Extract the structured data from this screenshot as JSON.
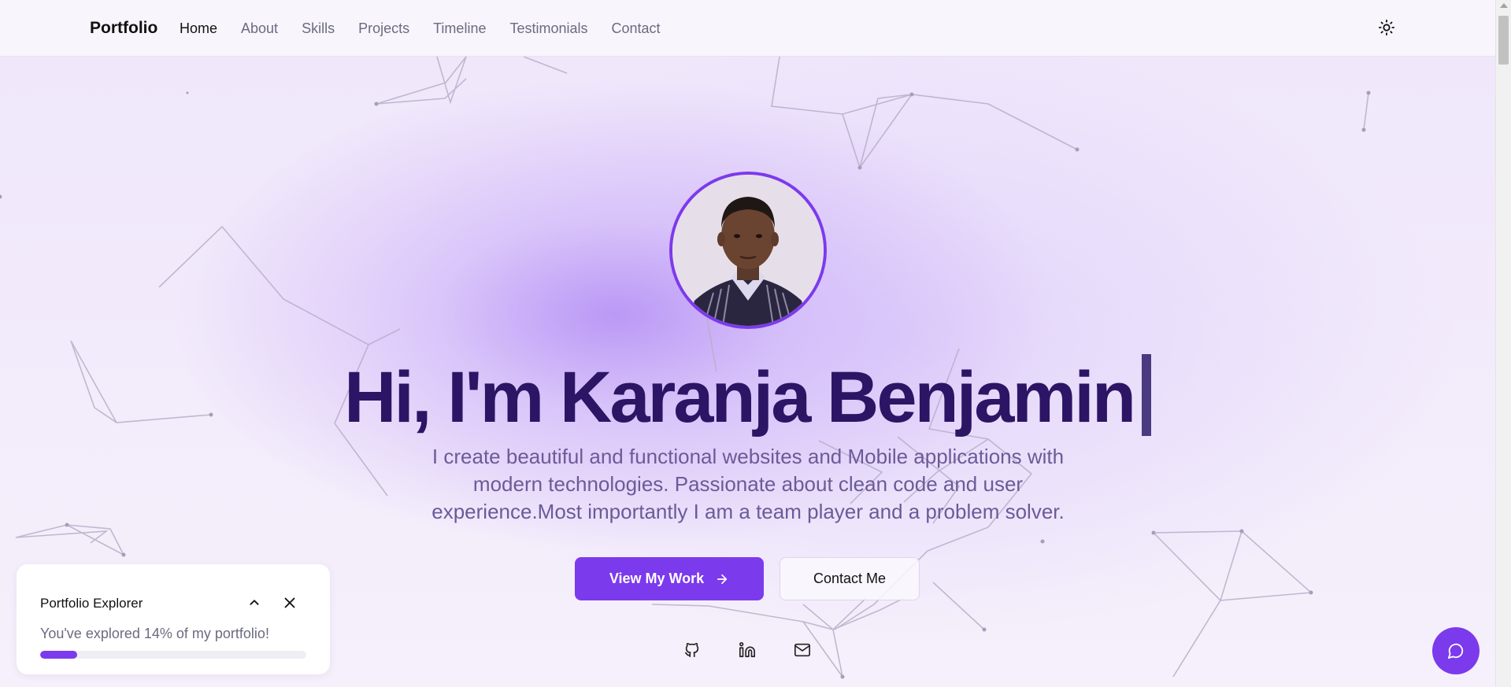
{
  "nav": {
    "brand": "Portfolio",
    "links": [
      "Home",
      "About",
      "Skills",
      "Projects",
      "Timeline",
      "Testimonials",
      "Contact"
    ],
    "active": "Home",
    "theme_icon": "sun-icon"
  },
  "hero": {
    "headline": "Hi, I'm Karanja Benjamin",
    "lead": "I create beautiful and functional websites and Mobile applications with modern technologies. Passionate about clean code and user experience.Most importantly I am a team player and a problem solver.",
    "primary_cta": "View My Work",
    "secondary_cta": "Contact Me",
    "socials": [
      "github-icon",
      "linkedin-icon",
      "mail-icon"
    ]
  },
  "explorer": {
    "title": "Portfolio Explorer",
    "message": "You've explored 14% of my portfolio!",
    "progress": 0.14
  },
  "chat": {
    "icon": "chat-bubble-icon"
  },
  "colors": {
    "accent": "#7c3aed",
    "headline": "#2d1565",
    "muted": "#6b6b80"
  }
}
